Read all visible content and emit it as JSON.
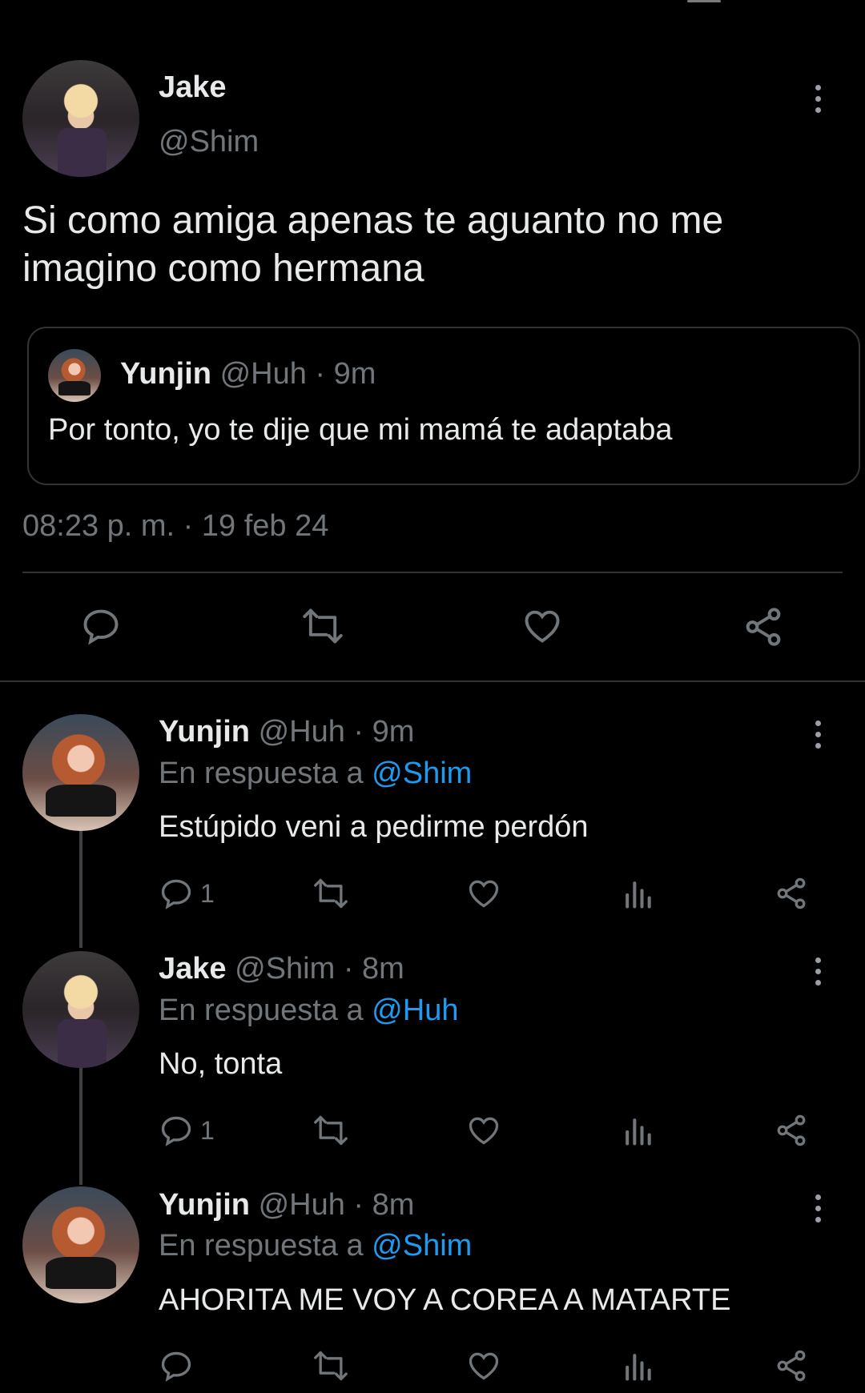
{
  "main_tweet": {
    "name": "Jake",
    "handle": "@Shim",
    "text": "Si como amiga apenas te aguanto no me imagino como hermana",
    "quote": {
      "name": "Yunjin",
      "handle_time": "@Huh · 9m",
      "text": "Por tonto, yo te dije que mi mamá te adaptaba"
    },
    "timestamp": "08:23 p. m. · 19 feb 24"
  },
  "replies": [
    {
      "name": "Yunjin",
      "handle_time": "@Huh · 9m",
      "reply_prefix": "En respuesta a",
      "reply_mention": "@Shim",
      "text": "Estúpido veni a pedirme perdón",
      "reply_count": "1"
    },
    {
      "name": "Jake",
      "handle_time": "@Shim · 8m",
      "reply_prefix": "En respuesta a",
      "reply_mention": "@Huh",
      "text": "No, tonta",
      "reply_count": "1"
    },
    {
      "name": "Yunjin",
      "handle_time": "@Huh · 8m",
      "reply_prefix": "En respuesta a",
      "reply_mention": "@Shim",
      "text": "AHORITA ME VOY A COREA A MATARTE",
      "reply_count": ""
    }
  ],
  "icons": {
    "reply": "reply-icon",
    "retweet": "retweet-icon",
    "like": "heart-icon",
    "views": "views-icon",
    "share": "share-icon",
    "more": "more-options-icon"
  },
  "colors": {
    "background": "#000000",
    "text": "#e7e9ea",
    "muted": "#71767b",
    "link": "#1d9bf0",
    "border": "#2f3336"
  }
}
